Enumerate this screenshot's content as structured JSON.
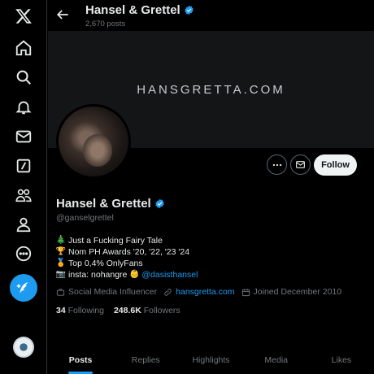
{
  "nav": {
    "items": [
      {
        "name": "x-logo-icon"
      },
      {
        "name": "home-icon"
      },
      {
        "name": "search-icon"
      },
      {
        "name": "notifications-icon"
      },
      {
        "name": "messages-icon"
      },
      {
        "name": "grok-icon"
      },
      {
        "name": "communities-icon"
      },
      {
        "name": "profile-icon"
      },
      {
        "name": "more-icon"
      }
    ],
    "compose": "compose-icon"
  },
  "header": {
    "name": "Hansel & Grettel",
    "post_count": "2,670 posts"
  },
  "banner": {
    "text": "HANSGRETTA.COM"
  },
  "actions": {
    "follow_label": "Follow"
  },
  "profile": {
    "display_name": "Hansel & Grettel",
    "handle": "@ganselgrettel",
    "bio": {
      "line1": "Just a Fucking Fairy Tale",
      "line2": "Nom PH Awards '20, '22, '23 '24",
      "line3": "Top 0,4% OnlyFans",
      "line4_prefix": "insta: nohangre",
      "line4_link": "@dasisthansel"
    },
    "category": "Social Media Influencer",
    "website": "hansgretta.com",
    "joined": "Joined December 2010",
    "following_count": "34",
    "following_label": "Following",
    "followers_count": "248.6K",
    "followers_label": "Followers"
  },
  "tabs": [
    "Posts",
    "Replies",
    "Highlights",
    "Media",
    "Likes"
  ],
  "colors": {
    "accent": "#1d9bf0",
    "background": "#000000",
    "muted": "#71767b",
    "text": "#e7e9ea"
  }
}
